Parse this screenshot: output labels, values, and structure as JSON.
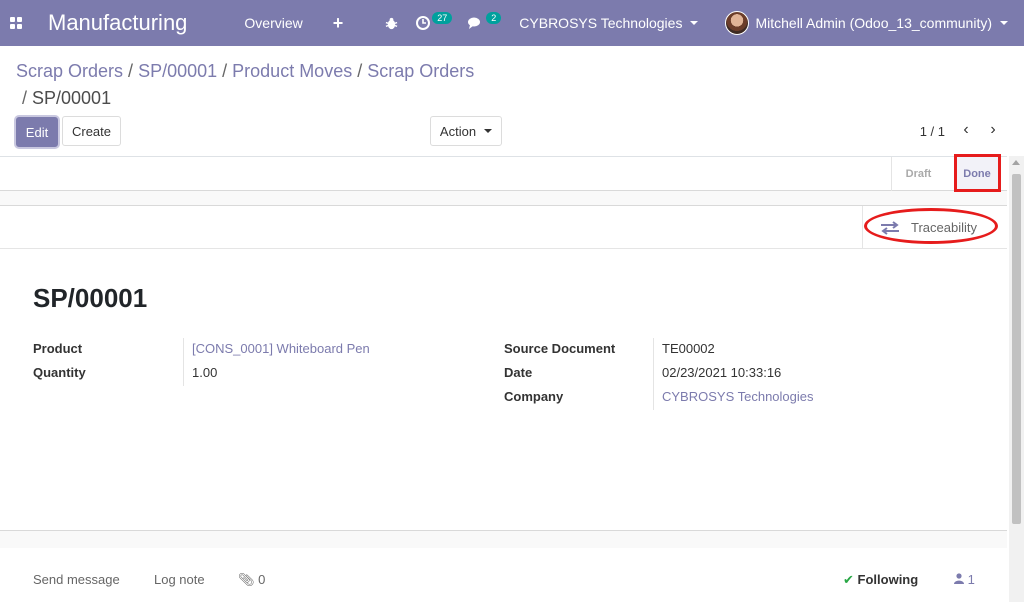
{
  "navbar": {
    "app_title": "Manufacturing",
    "menu_overview": "Overview",
    "plus_glyph": "+",
    "bug_icon": "bug-icon",
    "activity_count": "27",
    "message_count": "2",
    "company": "CYBROSYS Technologies",
    "user": "Mitchell Admin (Odoo_13_community)"
  },
  "breadcrumb": {
    "items": [
      "Scrap Orders",
      "SP/00001",
      "Product Moves",
      "Scrap Orders"
    ],
    "current": "SP/00001"
  },
  "toolbar": {
    "edit_label": "Edit",
    "create_label": "Create",
    "action_label": "Action",
    "pager": "1 / 1"
  },
  "statusbar": {
    "draft": "Draft",
    "done": "Done",
    "active": "Done"
  },
  "smart_button": {
    "traceability_label": "Traceability"
  },
  "record": {
    "name": "SP/00001",
    "product_label": "Product",
    "product_value": "[CONS_0001] Whiteboard Pen",
    "quantity_label": "Quantity",
    "quantity_value": "1.00",
    "source_label": "Source Document",
    "source_value": "TE00002",
    "date_label": "Date",
    "date_value": "02/23/2021 10:33:16",
    "company_label": "Company",
    "company_value": "CYBROSYS Technologies"
  },
  "chatter": {
    "send_message": "Send message",
    "log_note": "Log note",
    "attachments": "0",
    "following": "Following",
    "followers": "1"
  },
  "colors": {
    "brand": "#7c7bad",
    "highlight": "#e61c1c",
    "success": "#28a745"
  }
}
